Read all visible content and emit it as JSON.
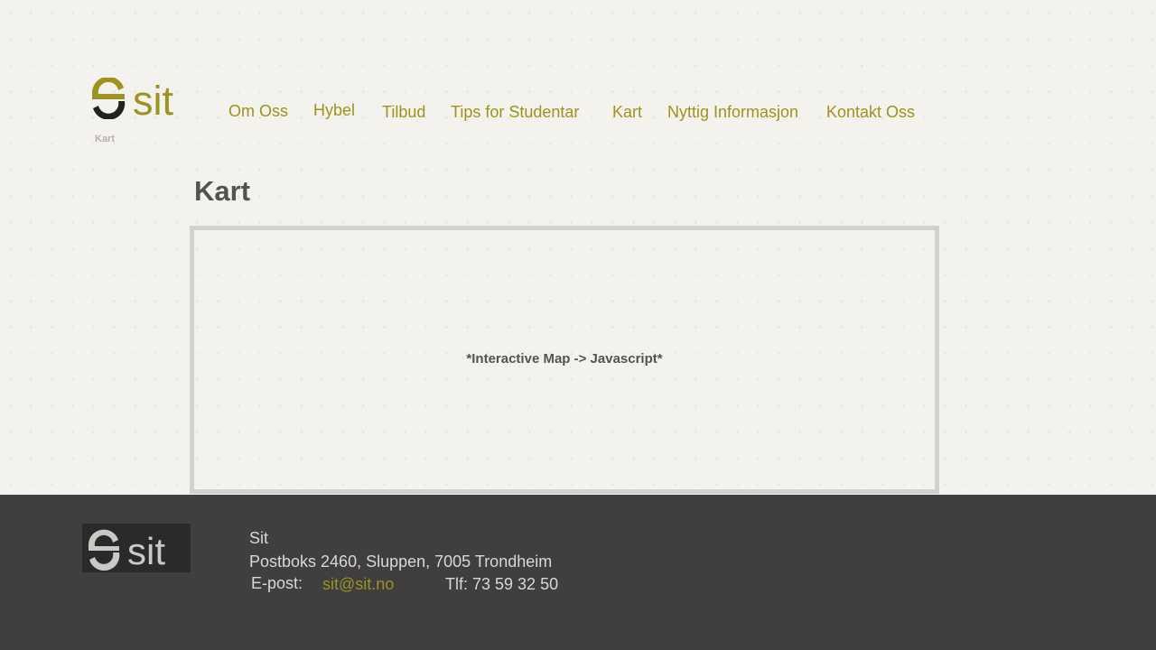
{
  "header": {
    "logo_text": "sit",
    "breadcrumb": "Kart"
  },
  "nav": {
    "items": [
      {
        "label": "Om Oss"
      },
      {
        "label": "Hybel"
      },
      {
        "label": "Tilbud"
      },
      {
        "label": "Tips for Studentar"
      },
      {
        "label": "Kart"
      },
      {
        "label": "Nyttig Informasjon"
      },
      {
        "label": "Kontakt Oss"
      }
    ]
  },
  "main": {
    "title": "Kart",
    "map_placeholder": "*Interactive Map -> Javascript*"
  },
  "footer": {
    "logo_text": "sit",
    "org_name": "Sit",
    "address": "Postboks 2460, Sluppen, 7005 Trondheim",
    "email_label": "E-post:",
    "email": "sit@sit.no",
    "phone": "Tlf: 73 59 32 50"
  },
  "colors": {
    "accent": "#9c9320",
    "background": "#f4f2ec",
    "footer_bg": "#403e3f",
    "heading": "#545352",
    "map_border": "#d2d1cd"
  }
}
